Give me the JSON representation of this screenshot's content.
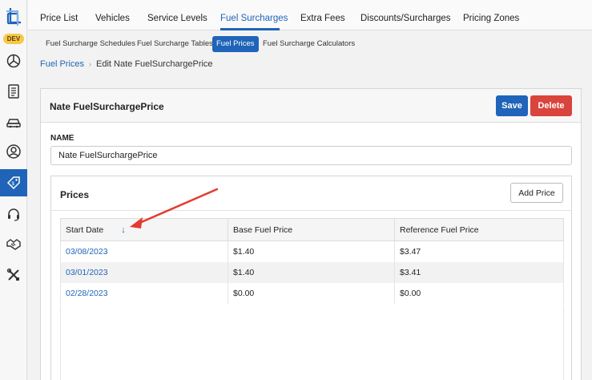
{
  "sidebar": {
    "env_badge": "DEV",
    "icons": [
      "logo-icon",
      "dashboard-icon",
      "document-icon",
      "car-icon",
      "user-icon",
      "price-tag-icon",
      "headset-icon",
      "handshake-icon",
      "tools-icon"
    ],
    "active_icon": "price-tag-icon"
  },
  "topnav": {
    "tabs": [
      {
        "label": "Price List"
      },
      {
        "label": "Vehicles"
      },
      {
        "label": "Service Levels"
      },
      {
        "label": "Fuel Surcharges"
      },
      {
        "label": "Extra Fees"
      },
      {
        "label": "Discounts/Surcharges"
      },
      {
        "label": "Pricing Zones"
      }
    ],
    "active": "Fuel Surcharges"
  },
  "subnav": {
    "tabs": [
      {
        "label": "Fuel Surcharge Schedules"
      },
      {
        "label": "Fuel Surcharge Tables"
      },
      {
        "label": "Fuel Prices"
      },
      {
        "label": "Fuel Surcharge Calculators"
      }
    ],
    "active": "Fuel Prices"
  },
  "breadcrumb": {
    "parent": "Fuel Prices",
    "separator": "›",
    "current": "Edit Nate FuelSurchargePrice"
  },
  "panel": {
    "title": "Nate FuelSurchargePrice",
    "save_label": "Save",
    "delete_label": "Delete",
    "name_label": "NAME",
    "name_value": "Nate FuelSurchargePrice"
  },
  "prices": {
    "title": "Prices",
    "add_label": "Add Price",
    "columns": [
      "Start Date",
      "Base Fuel Price",
      "Reference Fuel Price"
    ],
    "sort_indicator": "↓",
    "rows": [
      {
        "start_date": "03/08/2023",
        "base": "$1.40",
        "reference": "$3.47"
      },
      {
        "start_date": "03/01/2023",
        "base": "$1.40",
        "reference": "$3.41"
      },
      {
        "start_date": "02/28/2023",
        "base": "$0.00",
        "reference": "$0.00"
      }
    ]
  },
  "colors": {
    "accent": "#1f64b8",
    "danger": "#d9443d",
    "badge": "#f6c94a",
    "annotation": "#e53a2f"
  }
}
